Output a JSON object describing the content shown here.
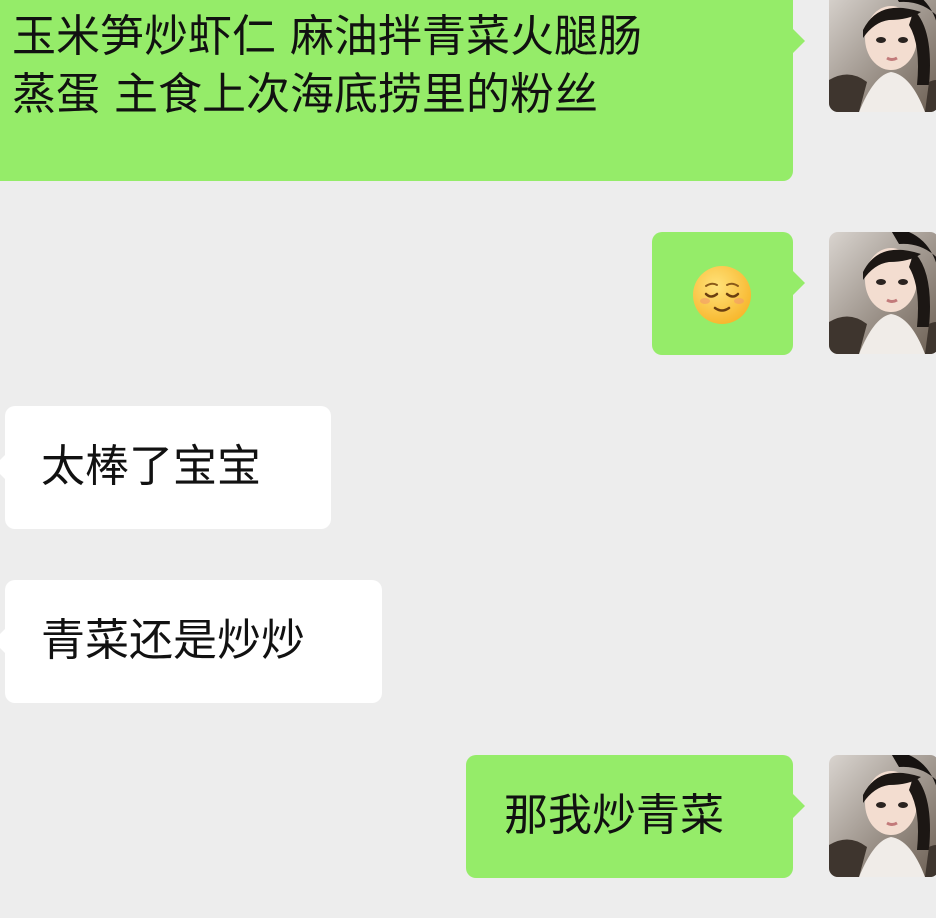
{
  "chat": {
    "messages": [
      {
        "id": "m1",
        "side": "sent",
        "lines": [
          "玉米笋炒虾仁 麻油拌青菜火腿肠",
          "蒸蛋 主食上次海底捞里的粉丝"
        ]
      },
      {
        "id": "m2",
        "side": "sent",
        "emoji": "relieved-face"
      },
      {
        "id": "m3",
        "side": "received",
        "text": "太棒了宝宝"
      },
      {
        "id": "m4",
        "side": "received",
        "text": "青菜还是炒炒"
      },
      {
        "id": "m5",
        "side": "sent",
        "text": "那我炒青菜"
      }
    ]
  },
  "colors": {
    "background": "#ededed",
    "sent_bubble": "#95ec69",
    "received_bubble": "#ffffff",
    "text": "#111111",
    "emoji_face": "#ffc83d"
  },
  "icons": {
    "self_avatar": "user-avatar-photo",
    "emoji": "relieved-face-emoji"
  }
}
